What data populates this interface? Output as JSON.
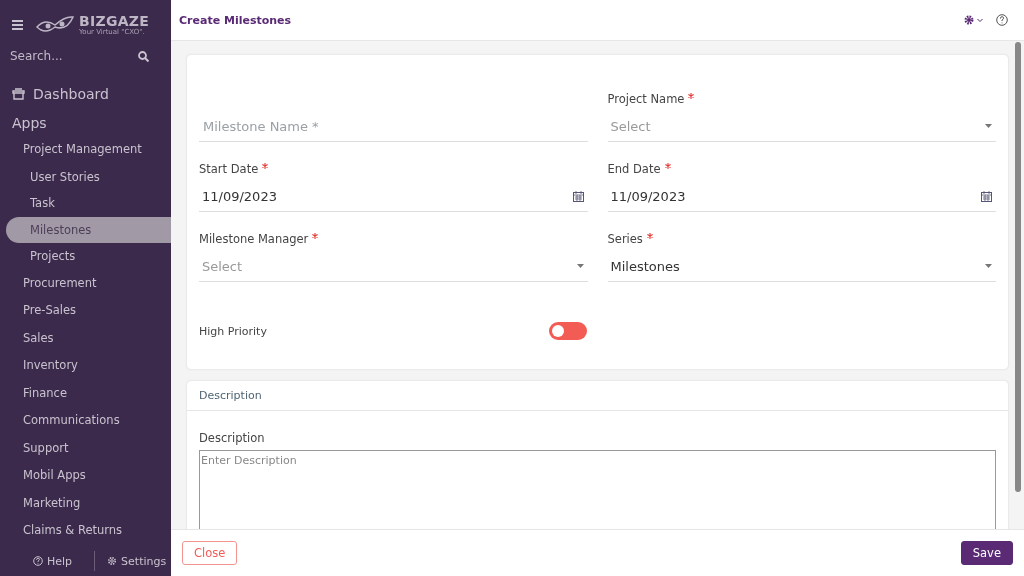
{
  "sidebar": {
    "logo": {
      "name": "BIZGAZE",
      "tagline": "Your Virtual \"CXO\"."
    },
    "search": {
      "placeholder": "Search..."
    },
    "dashboard": "Dashboard",
    "section": "Apps",
    "items": [
      {
        "label": "Project Management",
        "selected": false,
        "children": [
          {
            "label": "User Stories",
            "selected": false
          },
          {
            "label": "Task",
            "selected": false
          },
          {
            "label": "Milestones",
            "selected": true
          },
          {
            "label": "Projects",
            "selected": false
          }
        ]
      },
      {
        "label": "Procurement",
        "selected": false
      },
      {
        "label": "Pre-Sales",
        "selected": false
      },
      {
        "label": "Sales",
        "selected": false
      },
      {
        "label": "Inventory",
        "selected": false
      },
      {
        "label": "Finance",
        "selected": false
      },
      {
        "label": "Communications",
        "selected": false
      },
      {
        "label": "Support",
        "selected": false
      },
      {
        "label": "Mobil Apps",
        "selected": false
      },
      {
        "label": "Marketing",
        "selected": false
      },
      {
        "label": "Claims & Returns",
        "selected": false
      }
    ],
    "footer": [
      "Help",
      "Settings"
    ]
  },
  "header": {
    "title": "Create Milestones"
  },
  "form": {
    "fields": [
      {
        "kind": "text",
        "placeholder": "Milestone Name *"
      },
      {
        "kind": "date",
        "label": "Start Date",
        "required": true,
        "value": "11/09/2023"
      },
      {
        "kind": "select",
        "label": "Milestone Manager",
        "required": true,
        "placeholder": "Select"
      },
      {
        "kind": "select",
        "label": "Project Name",
        "required": true,
        "placeholder": "Select"
      },
      {
        "kind": "date",
        "label": "End Date",
        "required": true,
        "value": "11/09/2023"
      },
      {
        "kind": "select",
        "label": "Series",
        "required": true,
        "value": "Milestones"
      }
    ],
    "toggle": {
      "label": "High Priority",
      "on": false
    }
  },
  "description": {
    "heading": "Description",
    "label": "Description",
    "placeholder": "Enter Description"
  },
  "footer": {
    "buttons": [
      {
        "label": "Close",
        "kind": "secondary"
      },
      {
        "label": "Save",
        "kind": "primary"
      }
    ]
  }
}
